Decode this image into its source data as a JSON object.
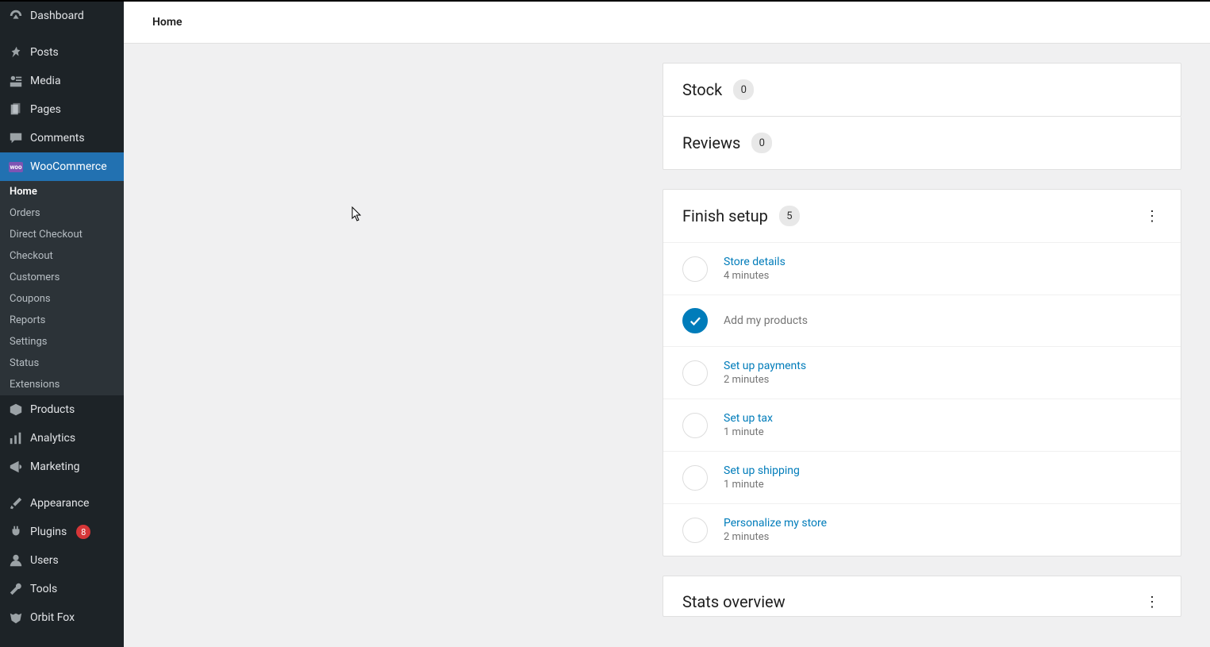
{
  "header": {
    "title": "Home"
  },
  "sidebar": {
    "top": [
      {
        "label": "Dashboard",
        "icon": "dash"
      },
      {
        "label": "Posts",
        "icon": "pin"
      },
      {
        "label": "Media",
        "icon": "media"
      },
      {
        "label": "Pages",
        "icon": "page"
      },
      {
        "label": "Comments",
        "icon": "comment"
      }
    ],
    "woo_label": "WooCommerce",
    "woo_sub": [
      {
        "label": "Home",
        "current": true
      },
      {
        "label": "Orders"
      },
      {
        "label": "Direct Checkout"
      },
      {
        "label": "Checkout"
      },
      {
        "label": "Customers"
      },
      {
        "label": "Coupons"
      },
      {
        "label": "Reports"
      },
      {
        "label": "Settings"
      },
      {
        "label": "Status"
      },
      {
        "label": "Extensions"
      }
    ],
    "bottom": [
      {
        "label": "Products",
        "icon": "box"
      },
      {
        "label": "Analytics",
        "icon": "chart"
      },
      {
        "label": "Marketing",
        "icon": "mega"
      },
      {
        "label": "Appearance",
        "icon": "brush"
      },
      {
        "label": "Plugins",
        "icon": "plug",
        "badge": "8"
      },
      {
        "label": "Users",
        "icon": "user"
      },
      {
        "label": "Tools",
        "icon": "wrench"
      },
      {
        "label": "Orbit Fox",
        "icon": "fox"
      }
    ]
  },
  "cards": {
    "stock": {
      "title": "Stock",
      "count": "0"
    },
    "reviews": {
      "title": "Reviews",
      "count": "0"
    },
    "finish": {
      "title": "Finish setup",
      "count": "5",
      "tasks": [
        {
          "title": "Store details",
          "time": "4 minutes",
          "done": false
        },
        {
          "title": "Add my products",
          "time": "",
          "done": true
        },
        {
          "title": "Set up payments",
          "time": "2 minutes",
          "done": false
        },
        {
          "title": "Set up tax",
          "time": "1 minute",
          "done": false
        },
        {
          "title": "Set up shipping",
          "time": "1 minute",
          "done": false
        },
        {
          "title": "Personalize my store",
          "time": "2 minutes",
          "done": false
        }
      ]
    },
    "stats": {
      "title": "Stats overview"
    }
  }
}
